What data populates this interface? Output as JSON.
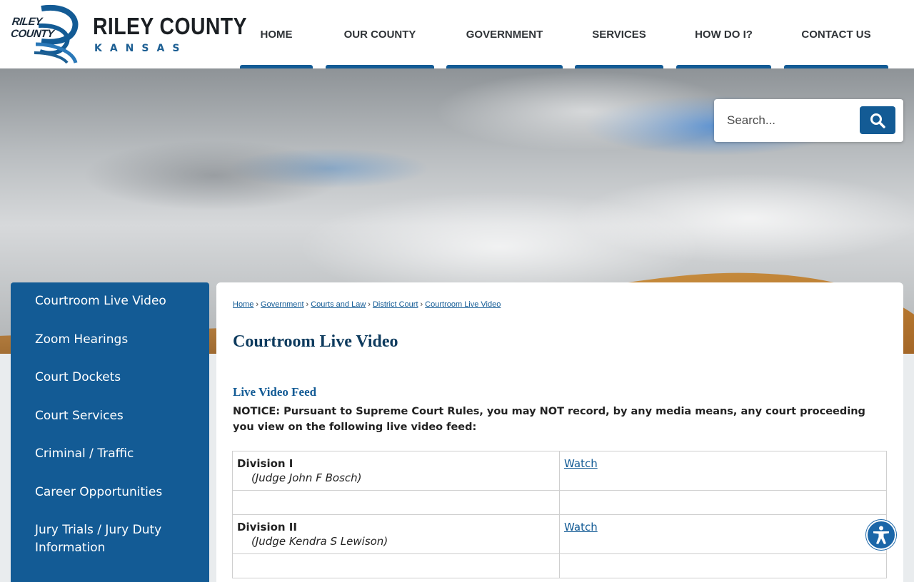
{
  "brand": {
    "mark_text": "RILEY COUNTY",
    "title": "RILEY COUNTY",
    "subtitle": "KANSAS",
    "primary_color": "#135b95",
    "dark_color": "#0e3b5e"
  },
  "nav": {
    "items": [
      {
        "label": "HOME"
      },
      {
        "label": "OUR COUNTY"
      },
      {
        "label": "GOVERNMENT"
      },
      {
        "label": "SERVICES"
      },
      {
        "label": "HOW DO I?"
      },
      {
        "label": "CONTACT US"
      }
    ]
  },
  "search": {
    "placeholder": "Search...",
    "icon": "search-icon"
  },
  "sidebar": {
    "items": [
      {
        "label": "Courtroom Live Video"
      },
      {
        "label": "Zoom Hearings"
      },
      {
        "label": "Court Dockets"
      },
      {
        "label": "Court Services"
      },
      {
        "label": "Criminal / Traffic"
      },
      {
        "label": "Career Opportunities"
      },
      {
        "label": "Jury Trials / Jury Duty Information"
      }
    ]
  },
  "breadcrumb": {
    "items": [
      {
        "label": "Home"
      },
      {
        "label": "Government"
      },
      {
        "label": "Courts and Law"
      },
      {
        "label": "District Court"
      },
      {
        "label": "Courtroom Live Video"
      }
    ],
    "separator": "›"
  },
  "main": {
    "title": "Courtroom Live Video",
    "section_title": "Live Video Feed",
    "notice": "NOTICE: Pursuant to Supreme Court Rules, you may NOT record, by any media means, any court proceeding you view on the following live video feed:",
    "rows": [
      {
        "division": "Division I",
        "judge": "(Judge John F Bosch)",
        "link": "Watch"
      },
      {
        "division": "Division II",
        "judge": "(Judge Kendra S Lewison)",
        "link": "Watch"
      }
    ]
  },
  "accessibility": {
    "icon": "accessibility-icon"
  }
}
